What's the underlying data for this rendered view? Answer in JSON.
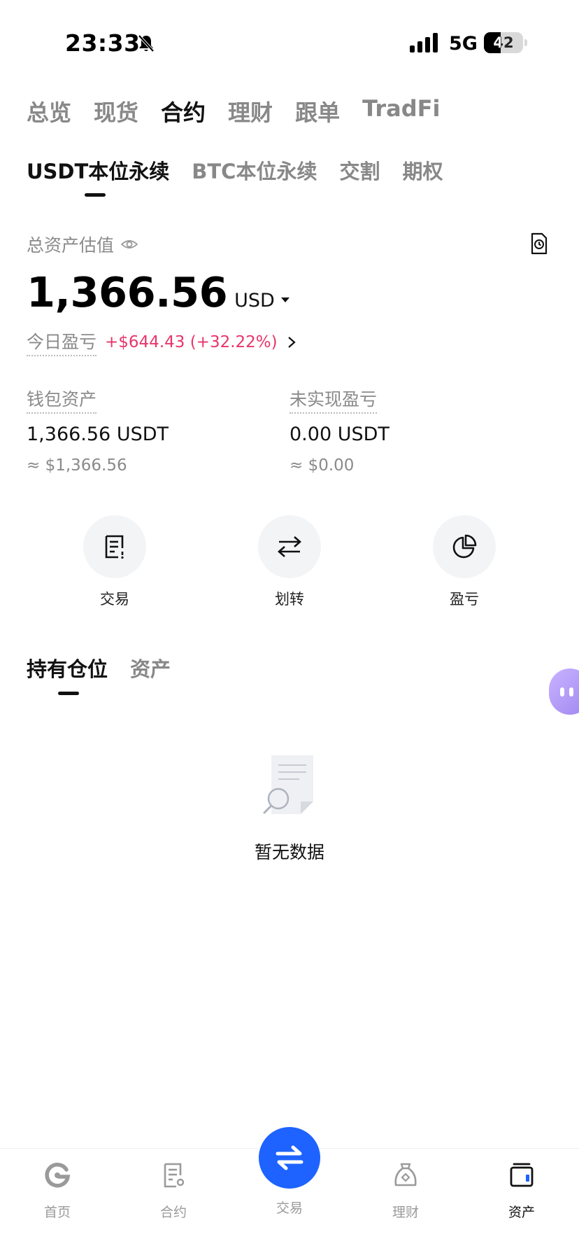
{
  "status_bar": {
    "time": "23:33",
    "network": "5G",
    "battery_level": "42",
    "battery_fraction": 0.42,
    "icons": [
      "bell-muted-icon",
      "signal-icon",
      "battery-icon"
    ]
  },
  "top_nav": {
    "items": [
      "总览",
      "现货",
      "合约",
      "理财",
      "跟单",
      "TradFi"
    ],
    "active_index": 2
  },
  "sub_nav": {
    "items": [
      "USDT本位永续",
      "BTC本位永续",
      "交割",
      "期权"
    ],
    "active_index": 0
  },
  "summary": {
    "label": "总资产估值",
    "amount": "1,366.56",
    "currency": "USD",
    "pnl_label": "今日盈亏",
    "pnl_value": "+$644.43 (+32.22%)"
  },
  "wallet": {
    "label": "钱包资产",
    "value": "1,366.56 USDT",
    "approx": "≈ $1,366.56"
  },
  "unrealized": {
    "label": "未实现盈亏",
    "value": "0.00 USDT",
    "approx": "≈ $0.00"
  },
  "actions": [
    {
      "label": "交易",
      "icon": "trade-doc-icon"
    },
    {
      "label": "划转",
      "icon": "transfer-icon"
    },
    {
      "label": "盈亏",
      "icon": "pie-chart-icon"
    }
  ],
  "position_tabs": {
    "items": [
      "持有仓位",
      "资产"
    ],
    "active_index": 0
  },
  "empty_state": {
    "text": "暂无数据"
  },
  "bottom_nav": {
    "items": [
      {
        "label": "首页",
        "icon": "home-logo-icon"
      },
      {
        "label": "合约",
        "icon": "contract-icon"
      },
      {
        "label": "交易",
        "icon": "swap-icon"
      },
      {
        "label": "理财",
        "icon": "earn-icon"
      },
      {
        "label": "资产",
        "icon": "wallet-icon"
      }
    ],
    "active_index": 4
  },
  "colors": {
    "accent_blue": "#1e63ff",
    "profit_pink": "#e8356a",
    "muted_text": "#8a8a8a",
    "assistant_purple": "#b39dff"
  }
}
